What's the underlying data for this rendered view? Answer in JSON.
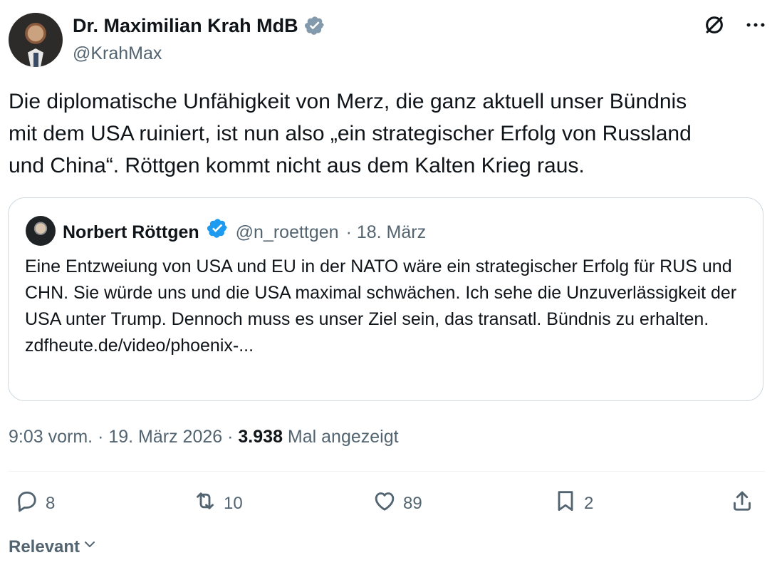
{
  "author": {
    "name": "Dr. Maximilian Krah MdB",
    "handle": "@KrahMax"
  },
  "tweet": {
    "text": "Die diplomatische Unfähigkeit von Merz, die ganz aktuell unser Bündnis\nmit dem USA ruiniert, ist nun also „ein strategischer Erfolg von Russland\nund China“. Röttgen kommt nicht aus dem Kalten Krieg raus."
  },
  "quote": {
    "name": "Norbert Röttgen",
    "handle": "@n_roettgen",
    "date": "· 18. März",
    "text": "Eine Entzweiung von USA und EU in der NATO wäre ein strategischer Erfolg für RUS und CHN. Sie würde uns und die USA maximal schwächen. Ich sehe die Unzuverlässigkeit der USA unter Trump. Dennoch muss es unser Ziel sein, das transatl. Bündnis zu erhalten.",
    "link": "zdfheute.de/video/phoenix-..."
  },
  "meta": {
    "time": "9:03 vorm.",
    "date": "19. März 2026",
    "views": "3.938",
    "views_label": "Mal angezeigt"
  },
  "actions": {
    "replies": "8",
    "reposts": "10",
    "likes": "89",
    "bookmarks": "2"
  },
  "sort": {
    "label": "Relevant"
  },
  "colors": {
    "verified_main": "#829aab",
    "verified_quote": "#1d9bf0",
    "secondary_text": "#536471",
    "primary_text": "#0f1419",
    "border": "#cfd9de"
  }
}
